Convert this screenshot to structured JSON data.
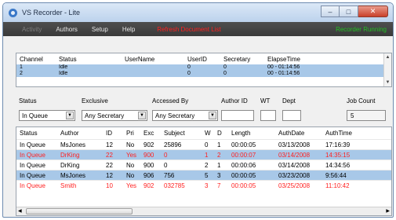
{
  "window": {
    "title": "VS Recorder - Lite",
    "icon": "recorder-app-icon"
  },
  "menu": {
    "items": [
      "Activity",
      "Authors",
      "Setup",
      "Help"
    ],
    "refresh": "Refresh Document List",
    "status": "Recorder Running"
  },
  "channels": {
    "columns": [
      "Channel",
      "Status",
      "UserName",
      "UserID",
      "Secretary",
      "ElapseTime"
    ],
    "rows": [
      [
        "1",
        "Idle",
        "",
        "0",
        "0",
        "00 - 01:14:56"
      ],
      [
        "2",
        "Idle",
        "",
        "0",
        "0",
        "00 - 01:14:56"
      ]
    ]
  },
  "filters": {
    "status_label": "Status",
    "status_value": "In Queue",
    "exclusive_label": "Exclusive",
    "exclusive_value": "Any Secretary",
    "accessed_label": "Accessed By",
    "accessed_value": "Any Secretary",
    "authorid_label": "Author ID",
    "wt_label": "WT",
    "dept_label": "Dept",
    "jobcount_label": "Job Count",
    "jobcount_value": "5"
  },
  "jobs": {
    "columns": [
      "Status",
      "Author",
      "ID",
      "Pri",
      "Exc",
      "Subject",
      "W",
      "D",
      "Length",
      "AuthDate",
      "AuthTime"
    ],
    "rows": [
      [
        "In Queue",
        "MsJones",
        "12",
        "No",
        "902",
        "25896",
        "0",
        "1",
        "00:00:05",
        "03/13/2008",
        "17:16:39"
      ],
      [
        "In Queue",
        "DrKing",
        "22",
        "Yes",
        "900",
        "0",
        "1",
        "2",
        "00:00:07",
        "03/14/2008",
        "14:35:15"
      ],
      [
        "In Queue",
        "DrKing",
        "22",
        "No",
        "900",
        "0",
        "2",
        "1",
        "00:00:06",
        "03/14/2008",
        "14:34:56"
      ],
      [
        "In Queue",
        "MsJones",
        "12",
        "No",
        "906",
        "756",
        "5",
        "3",
        "00:00:05",
        "03/23/2008",
        "9:56:44"
      ],
      [
        "In Queue",
        "Smith",
        "10",
        "Yes",
        "902",
        "032785",
        "3",
        "7",
        "00:00:05",
        "03/25/2008",
        "11:10:42"
      ]
    ]
  },
  "colors": {
    "selection": "#a8c8e8",
    "priority_text": "#ff1f1f",
    "running": "#22c022"
  }
}
